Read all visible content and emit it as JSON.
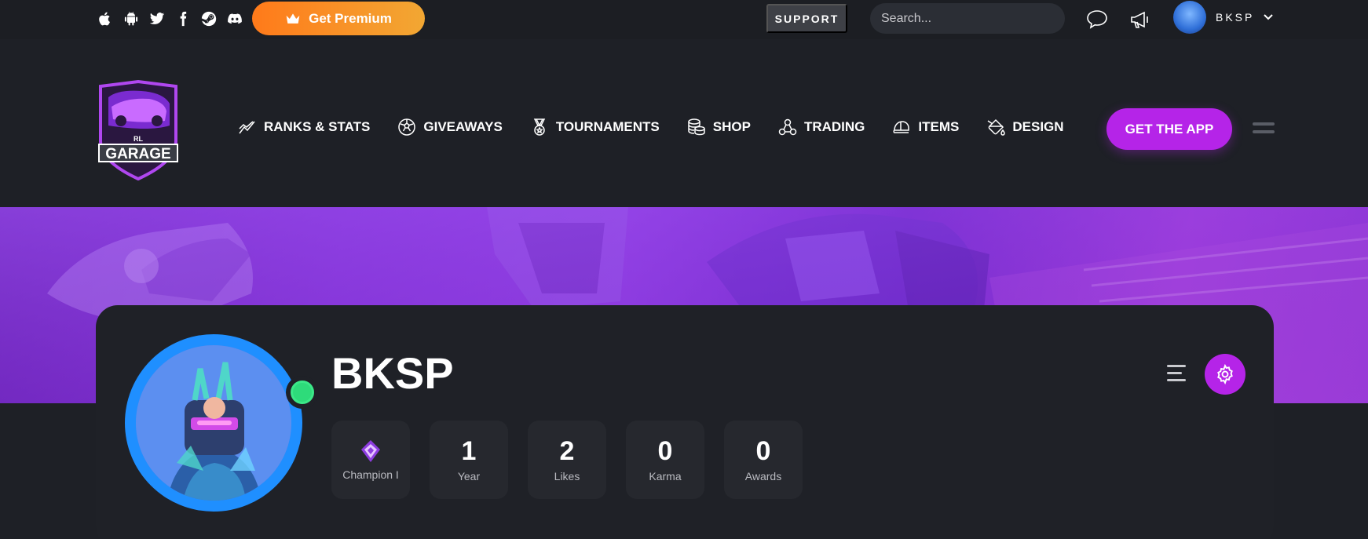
{
  "topbar": {
    "social": [
      "apple-icon",
      "android-icon",
      "twitter-icon",
      "facebook-icon",
      "steam-icon",
      "discord-icon"
    ],
    "premium_label": "Get Premium",
    "support_label": "SUPPORT",
    "search_placeholder": "Search...",
    "username": "BKSP"
  },
  "nav": {
    "items": [
      {
        "label": "RANKS & STATS",
        "icon": "chart-line-icon"
      },
      {
        "label": "GIVEAWAYS",
        "icon": "ball-icon"
      },
      {
        "label": "TOURNAMENTS",
        "icon": "medal-icon"
      },
      {
        "label": "SHOP",
        "icon": "coins-icon"
      },
      {
        "label": "TRADING",
        "icon": "network-icon"
      },
      {
        "label": "ITEMS",
        "icon": "cap-icon"
      },
      {
        "label": "DESIGN",
        "icon": "paint-bucket-icon"
      }
    ],
    "get_app_label": "GET THE APP"
  },
  "logo": {
    "top_text": "RL",
    "main_text": "GARAGE"
  },
  "profile": {
    "name": "BKSP",
    "online": true,
    "stats": [
      {
        "value": "",
        "label": "Champion I",
        "icon": "rank-icon"
      },
      {
        "value": "1",
        "label": "Year"
      },
      {
        "value": "2",
        "label": "Likes"
      },
      {
        "value": "0",
        "label": "Karma"
      },
      {
        "value": "0",
        "label": "Awards"
      }
    ]
  },
  "colors": {
    "accent": "#b524e8",
    "premium": "#ff7a1a",
    "online": "#2edb7a",
    "bg": "#1e2026"
  }
}
